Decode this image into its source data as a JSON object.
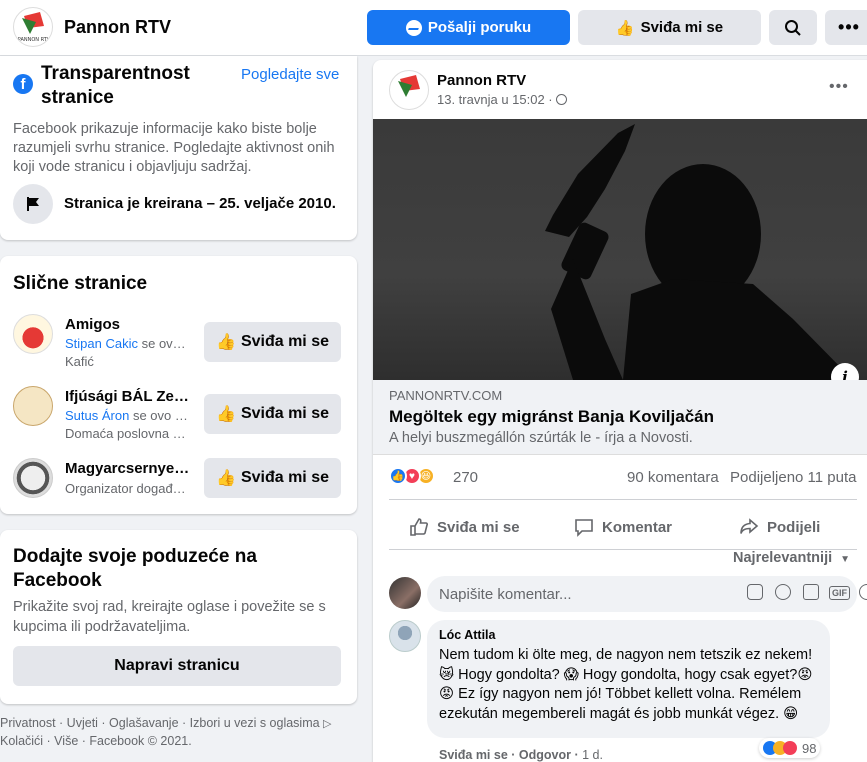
{
  "header": {
    "page_name": "Pannon RTV",
    "logo_text": "PANNON RTV",
    "message_button": "Pošalji poruku",
    "like_button": "Sviđa mi se"
  },
  "transparency": {
    "title": "Transparentnost stranice",
    "see_all": "Pogledajte sve",
    "description": "Facebook prikazuje informacije kako biste bolje razumjeli svrhu stranice. Pogledajte aktivnost onih koji vode stranicu i objavljuju sadržaj.",
    "created": "Stranica je kreirana – 25. veljače 2010."
  },
  "similar": {
    "title": "Slične stranice",
    "like_label": "Sviđa mi se",
    "items": [
      {
        "name": "Amigos",
        "friend": "Stipan Cakic",
        "friend_suffix": "se ov…",
        "category": "Kafić"
      },
      {
        "name": "Ifjúsági BÁL Ze…",
        "friend": "Sutus Áron",
        "friend_suffix": "se ovo …",
        "category": "Domaća poslovna …"
      },
      {
        "name": "Magyarcsernye…",
        "friend": "",
        "friend_suffix": "",
        "category": "Organizator događ…"
      }
    ]
  },
  "business": {
    "title": "Dodajte svoje poduzeće na Facebook",
    "description": "Prikažite svoj rad, kreirajte oglase i povežite se s kupcima ili podržavateljima.",
    "button": "Napravi stranicu"
  },
  "footer": {
    "line1": "Privatnost · Uvjeti · Oglašavanje · Izbori u vezi s oglasima",
    "line2": "Kolačići · Više · Facebook © 2021."
  },
  "post": {
    "author": "Pannon RTV",
    "time": "13. travnja u 15:02 ·",
    "link_domain": "PANNONRTV.COM",
    "link_title": "Megöltek egy migránst Banja Koviljačán",
    "link_subtitle": "A helyi buszmegállón szúrták le - írja a Novosti.",
    "info_icon": "i",
    "reactions_count": "270",
    "comments_count": "90 komentara",
    "shares_count": "Podijeljeno 11 puta",
    "actions": {
      "like": "Sviđa mi se",
      "comment": "Komentar",
      "share": "Podijeli"
    },
    "sort_label": "Najrelevantniji",
    "comment_placeholder": "Napišite komentar...",
    "gif_label": "GIF"
  },
  "comment": {
    "author": "Lóc Attila",
    "text": "Nem tudom ki ölte meg, de nagyon nem tetszik ez nekem! 😿 Hogy gondolta? 😱 Hogy gondolta, hogy csak egyet?😡😡 Ez így nagyon nem jó! Többet kellett volna. Remélem ezekután megembereli magát és jobb munkát végez. 😁",
    "like": "Sviđa mi se",
    "reply": "Odgovor",
    "age": "1 d.",
    "reactions_count": "98"
  },
  "colors": {
    "accent": "#1877f2",
    "background": "#f0f2f5",
    "secondary_text": "#65676b"
  }
}
